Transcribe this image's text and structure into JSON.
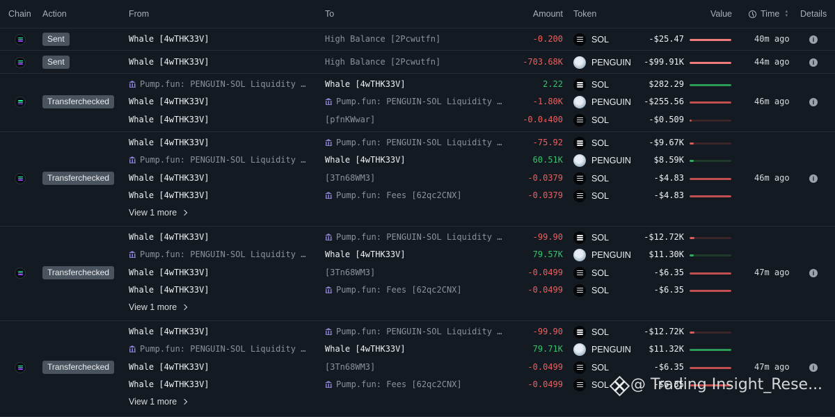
{
  "header": {
    "chain": "Chain",
    "action": "Action",
    "from": "From",
    "to": "To",
    "amount": "Amount",
    "token": "Token",
    "value": "Value",
    "time": "Time",
    "details": "Details"
  },
  "colors": {
    "negative": "#ef5f5f",
    "positive": "#36c46f",
    "badge": "#4a545e",
    "background": "#131a21"
  },
  "groups": [
    {
      "action": "Sent",
      "time": "40m ago",
      "rows": [
        {
          "from": "Whale [4wTHK33V]",
          "to": "High Balance [2Pcwutfn]",
          "amount": "-0.200",
          "token": "SOL",
          "value": "-$25.47",
          "bar": 1.0
        }
      ]
    },
    {
      "action": "Sent",
      "time": "44m ago",
      "rows": [
        {
          "from": "Whale [4wTHK33V]",
          "to": "High Balance [2Pcwutfn]",
          "amount": "-703.68K",
          "token": "PENGUIN",
          "value": "-$99.91K",
          "bar": 1.0
        }
      ]
    },
    {
      "action": "Transferchecked",
      "time": "46m ago",
      "rows": [
        {
          "from": "Pump.fun: PENGUIN-SOL Liquidity …",
          "to": "Whale [4wTHK33V]",
          "amount": "2.22",
          "token": "SOL",
          "value": "$282.29",
          "bar": 1.0
        },
        {
          "from": "Whale [4wTHK33V]",
          "to": "Pump.fun: PENGUIN-SOL Liquidity …",
          "amount": "-1.80K",
          "token": "PENGUIN",
          "value": "-$255.56",
          "bar": 1.0
        },
        {
          "from": "Whale [4wTHK33V]",
          "to": "[pfnKWwar]",
          "amount": "-0.0₄400",
          "token": "SOL",
          "value": "-$0.509",
          "bar": 0.05
        }
      ]
    },
    {
      "action": "Transferchecked",
      "time": "46m ago",
      "view_more": "View 1 more",
      "rows": [
        {
          "from": "Whale [4wTHK33V]",
          "to": "Pump.fun: PENGUIN-SOL Liquidity …",
          "amount": "-75.92",
          "token": "SOL",
          "value": "-$9.67K",
          "bar": 0.1
        },
        {
          "from": "Pump.fun: PENGUIN-SOL Liquidity …",
          "to": "Whale [4wTHK33V]",
          "amount": "60.51K",
          "token": "PENGUIN",
          "value": "$8.59K",
          "bar": 0.1
        },
        {
          "from": "Whale [4wTHK33V]",
          "to": "[3Tn68WM3]",
          "amount": "-0.0379",
          "token": "SOL",
          "value": "-$4.83",
          "bar": 1.0
        },
        {
          "from": "Whale [4wTHK33V]",
          "to": "Pump.fun: Fees [62qc2CNX]",
          "amount": "-0.0379",
          "token": "SOL",
          "value": "-$4.83",
          "bar": 1.0
        }
      ]
    },
    {
      "action": "Transferchecked",
      "time": "47m ago",
      "view_more": "View 1 more",
      "rows": [
        {
          "from": "Whale [4wTHK33V]",
          "to": "Pump.fun: PENGUIN-SOL Liquidity …",
          "amount": "-99.90",
          "token": "SOL",
          "value": "-$12.72K",
          "bar": 0.12
        },
        {
          "from": "Pump.fun: PENGUIN-SOL Liquidity …",
          "to": "Whale [4wTHK33V]",
          "amount": "79.57K",
          "token": "PENGUIN",
          "value": "$11.30K",
          "bar": 0.1
        },
        {
          "from": "Whale [4wTHK33V]",
          "to": "[3Tn68WM3]",
          "amount": "-0.0499",
          "token": "SOL",
          "value": "-$6.35",
          "bar": 1.0
        },
        {
          "from": "Whale [4wTHK33V]",
          "to": "Pump.fun: Fees [62qc2CNX]",
          "amount": "-0.0499",
          "token": "SOL",
          "value": "-$6.35",
          "bar": 1.0
        }
      ]
    },
    {
      "action": "Transferchecked",
      "time": "47m ago",
      "view_more": "View 1 more",
      "rows": [
        {
          "from": "Whale [4wTHK33V]",
          "to": "Pump.fun: PENGUIN-SOL Liquidity …",
          "amount": "-99.90",
          "token": "SOL",
          "value": "-$12.72K",
          "bar": 0.12
        },
        {
          "from": "Pump.fun: PENGUIN-SOL Liquidity …",
          "to": "Whale [4wTHK33V]",
          "amount": "79.71K",
          "token": "PENGUIN",
          "value": "$11.32K",
          "bar": 1.0
        },
        {
          "from": "Whale [4wTHK33V]",
          "to": "[3Tn68WM3]",
          "amount": "-0.0499",
          "token": "SOL",
          "value": "-$6.35",
          "bar": 1.0
        },
        {
          "from": "Whale [4wTHK33V]",
          "to": "Pump.fun: Fees [62qc2CNX]",
          "amount": "-0.0499",
          "token": "SOL",
          "value": "-$6.35",
          "bar": 1.0
        }
      ]
    }
  ],
  "watermark": "@ Trading Insight_Rese..."
}
